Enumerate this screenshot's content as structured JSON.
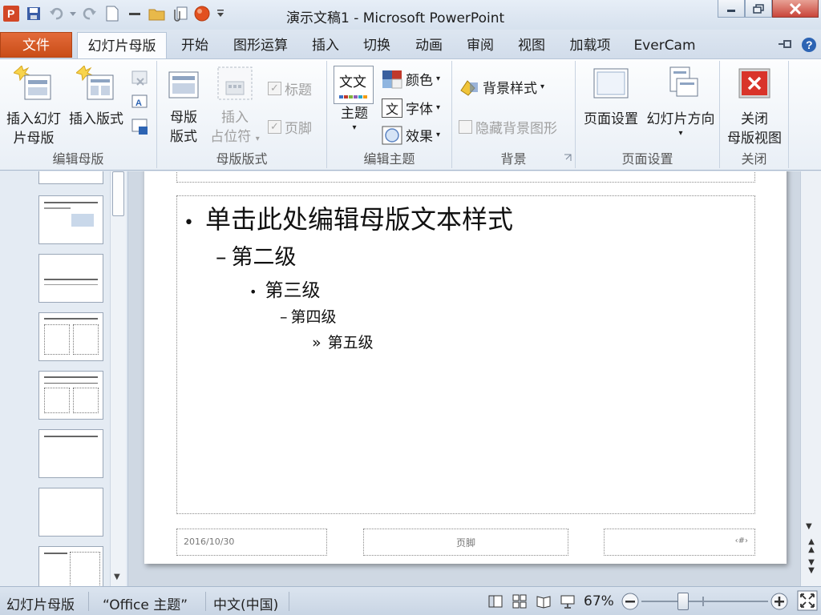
{
  "window": {
    "title": "演示文稿1 - Microsoft PowerPoint"
  },
  "tabs": [
    {
      "label": "文件"
    },
    {
      "label": "幻灯片母版"
    },
    {
      "label": "开始"
    },
    {
      "label": "图形运算"
    },
    {
      "label": "插入"
    },
    {
      "label": "切换"
    },
    {
      "label": "动画"
    },
    {
      "label": "审阅"
    },
    {
      "label": "视图"
    },
    {
      "label": "加载项"
    },
    {
      "label": "EverCam"
    }
  ],
  "ribbon": {
    "groups": {
      "edit_master": "编辑母版",
      "master_layout": "母版版式",
      "edit_theme": "编辑主题",
      "background": "背景",
      "page_setup": "页面设置",
      "close": "关闭"
    },
    "insert_master_line1": "插入幻灯",
    "insert_master_line2": "片母版",
    "insert_layout": "插入版式",
    "master_layout_line1": "母版",
    "master_layout_line2": "版式",
    "insert_placeholder_line1": "插入",
    "insert_placeholder_line2": "占位符",
    "title_check": "标题",
    "footer_check": "页脚",
    "theme": "主题",
    "theme_icon_text": "文文",
    "colors": "颜色",
    "fonts": "字体",
    "fonts_icon_text": "文",
    "effects": "效果",
    "background_styles": "背景样式",
    "hide_background": "隐藏背景图形",
    "page_setup_btn": "页面设置",
    "slide_orientation": "幻灯片方向",
    "close_line1": "关闭",
    "close_line2": "母版视图"
  },
  "slide": {
    "level1": "单击此处编辑母版文本样式",
    "level2": "第二级",
    "level3": "第三级",
    "level4": "第四级",
    "level5": "第五级",
    "bullet1": "•",
    "bullet2": "–",
    "bullet3": "•",
    "bullet4": "–",
    "bullet5": "»",
    "date": "2016/10/30",
    "footer": "页脚",
    "slide_number": "‹#›"
  },
  "statusbar": {
    "view": "幻灯片母版",
    "theme": "“Office 主题”",
    "language": "中文(中国)",
    "zoom": "67%"
  },
  "colors": {
    "file_tab": "#d4591f",
    "accent": "#2b579a"
  }
}
